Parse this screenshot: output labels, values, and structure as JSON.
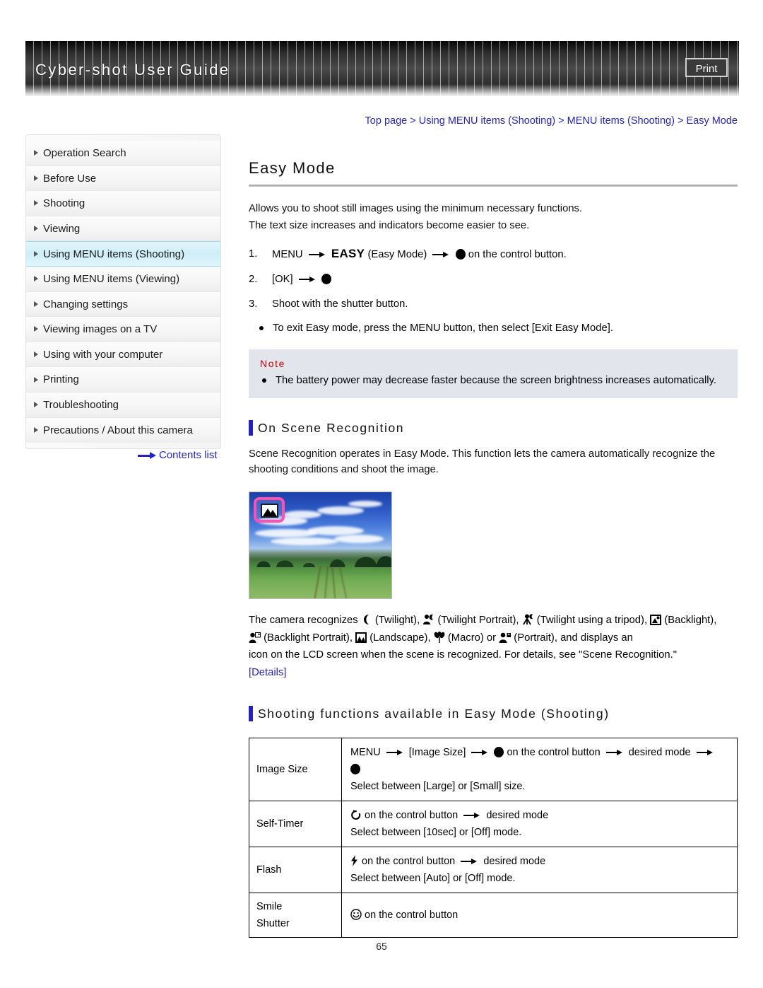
{
  "header": {
    "title": "Cyber-shot User Guide",
    "print_label": "Print"
  },
  "breadcrumb": {
    "text": "Top page > Using MENU items (Shooting) > MENU items (Shooting) > Easy Mode"
  },
  "sidebar": {
    "items": [
      {
        "label": "Operation Search",
        "active": false
      },
      {
        "label": "Before Use",
        "active": false
      },
      {
        "label": "Shooting",
        "active": false
      },
      {
        "label": "Viewing",
        "active": false
      },
      {
        "label": "Using MENU items (Shooting)",
        "active": true
      },
      {
        "label": "Using MENU items (Viewing)",
        "active": false
      },
      {
        "label": "Changing settings",
        "active": false
      },
      {
        "label": "Viewing images on a TV",
        "active": false
      },
      {
        "label": "Using with your computer",
        "active": false
      },
      {
        "label": "Printing",
        "active": false
      },
      {
        "label": "Troubleshooting",
        "active": false
      },
      {
        "label": "Precautions / About this camera",
        "active": false
      }
    ],
    "contents_link": "Contents list"
  },
  "main": {
    "title": "Easy Mode",
    "intro_line1": "Allows you to shoot still images using the minimum necessary functions.",
    "intro_line2": "The text size increases and indicators become easier to see.",
    "steps": {
      "s1_num": "1.",
      "s1_menu": "MENU",
      "s1_easy": "EASY",
      "s1_easy_paren": "(Easy Mode)",
      "s1_tail": "on the control button.",
      "s2_num": "2.",
      "s2_ok": "[OK]",
      "s3_num": "3.",
      "s3_text": "Shoot with the shutter button.",
      "s3_bullet": "To exit Easy mode, press the MENU button, then select [Exit Easy Mode]."
    },
    "note": {
      "heading": "Note",
      "body": "The battery power may decrease faster because the screen brightness increases automatically."
    },
    "scene_section": {
      "heading": "On Scene Recognition",
      "para": "Scene Recognition operates in Easy Mode. This function lets the camera automatically recognize the shooting conditions and shoot the image.",
      "recognize_intro": "The camera recognizes",
      "labels": {
        "twilight": "(Twilight),",
        "twilight_portrait": "(Twilight Portrait),",
        "twilight_tripod": "(Twilight using a tripod),",
        "backlight": "(Backlight),",
        "backlight_portrait": "(Backlight Portrait),",
        "landscape": "(Landscape),",
        "macro": "(Macro) or",
        "portrait": "(Portrait), and displays an"
      },
      "tail": "icon on the LCD screen when the scene is recognized. For details, see \"Scene Recognition.\"",
      "details_link": "[Details]"
    },
    "table_section": {
      "heading": "Shooting functions available in Easy Mode (Shooting)",
      "rows": [
        {
          "label": "Image Size",
          "line1_a": "MENU",
          "line1_b": "[Image Size]",
          "line1_c": "on the control button",
          "line1_d": "desired mode",
          "line3": "Select between [Large] or [Small] size."
        },
        {
          "label": "Self-Timer",
          "line1_a": "on the control button",
          "line1_b": "desired mode",
          "line2": "Select between [10sec] or [Off] mode."
        },
        {
          "label": "Flash",
          "line1_a": "on the control button",
          "line1_b": "desired mode",
          "line2": "Select between [Auto] or [Off] mode."
        },
        {
          "label_line1": "Smile",
          "label_line2": "Shutter",
          "line1_a": "on the control button"
        }
      ]
    },
    "page_number": "65"
  },
  "colors": {
    "link": "#2323c8",
    "note_bg": "#e2e6ec",
    "note_heading": "#cc0000",
    "section_bar": "#2222bb",
    "sidebar_active": "#cfeef8",
    "scene_frame": "#ff4fb0"
  }
}
